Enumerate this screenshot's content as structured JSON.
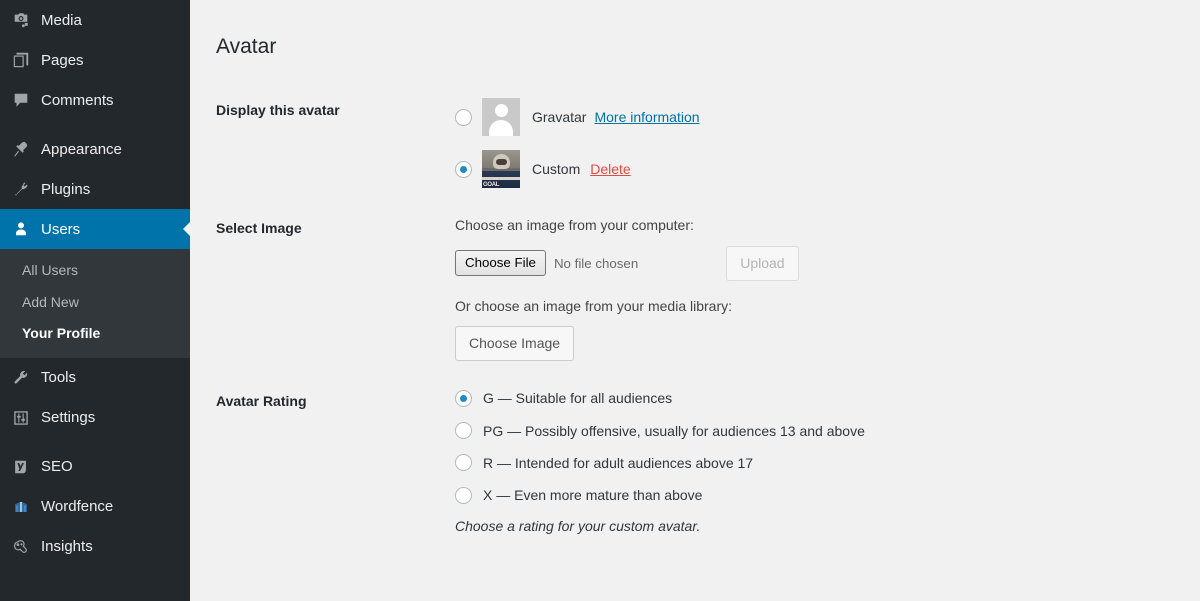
{
  "sidebar": {
    "items": [
      {
        "label": "Media",
        "icon": "media-icon",
        "active": false
      },
      {
        "label": "Pages",
        "icon": "pages-icon",
        "active": false
      },
      {
        "label": "Comments",
        "icon": "comments-icon",
        "active": false
      },
      {
        "label": "Appearance",
        "icon": "appearance-icon",
        "active": false
      },
      {
        "label": "Plugins",
        "icon": "plugins-icon",
        "active": false
      },
      {
        "label": "Users",
        "icon": "users-icon",
        "active": true
      },
      {
        "label": "Tools",
        "icon": "tools-icon",
        "active": false
      },
      {
        "label": "Settings",
        "icon": "settings-icon",
        "active": false
      },
      {
        "label": "SEO",
        "icon": "seo-icon",
        "active": false
      },
      {
        "label": "Wordfence",
        "icon": "wordfence-icon",
        "active": false
      },
      {
        "label": "Insights",
        "icon": "insights-icon",
        "active": false
      }
    ],
    "submenu": [
      {
        "label": "All Users",
        "current": false
      },
      {
        "label": "Add New",
        "current": false
      },
      {
        "label": "Your Profile",
        "current": true
      }
    ],
    "colors": {
      "background": "#23282d",
      "submenu_background": "#32373c",
      "active_background": "#0073aa",
      "label_color": "#eeeeee"
    }
  },
  "main": {
    "page_title": "Avatar",
    "background": "#f1f1f1",
    "sections": {
      "display_avatar": {
        "label": "Display this avatar",
        "options": [
          {
            "id": "gravatar",
            "caption": "Gravatar",
            "link_label": "More information",
            "link_color": "#0073aa",
            "selected": false,
            "thumb": "gravatar-placeholder"
          },
          {
            "id": "custom",
            "caption": "Custom",
            "link_label": "Delete",
            "link_color": "#e14d43",
            "selected": true,
            "thumb": "custom-photo",
            "thumb_textmark": "GOAL"
          }
        ]
      },
      "select_image": {
        "label": "Select Image",
        "computer_help": "Choose an image from your computer:",
        "file_button_label": "Choose File",
        "file_status": "No file chosen",
        "upload_button_label": "Upload",
        "upload_disabled": true,
        "library_help": "Or choose an image from your media library:",
        "choose_image_button_label": "Choose Image"
      },
      "avatar_rating": {
        "label": "Avatar Rating",
        "options": [
          {
            "id": "G",
            "label": "G — Suitable for all audiences",
            "selected": true
          },
          {
            "id": "PG",
            "label": "PG — Possibly offensive, usually for audiences 13 and above",
            "selected": false
          },
          {
            "id": "R",
            "label": "R — Intended for adult audiences above 17",
            "selected": false
          },
          {
            "id": "X",
            "label": "X — Even more mature than above",
            "selected": false
          }
        ],
        "description": "Choose a rating for your custom avatar."
      }
    }
  }
}
